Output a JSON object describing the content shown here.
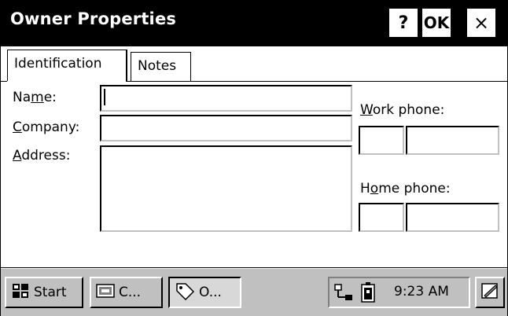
{
  "window": {
    "title": "Owner Properties",
    "help_label": "?",
    "ok_label": "OK",
    "close_label": "×"
  },
  "tabs": [
    {
      "label": "Identification",
      "active": true
    },
    {
      "label": "Notes",
      "active": false
    }
  ],
  "form": {
    "name_label": {
      "pre": "Na",
      "mn": "m",
      "post": "e:"
    },
    "company_label": {
      "pre": "",
      "mn": "C",
      "post": "ompany:"
    },
    "address_label": {
      "pre": "",
      "mn": "A",
      "post": "ddress:"
    },
    "work_phone_label": {
      "pre": "",
      "mn": "W",
      "post": "ork phone:"
    },
    "home_phone_label": {
      "pre": "H",
      "mn": "o",
      "post": "me phone:"
    },
    "name_value": "",
    "company_value": "",
    "address_value": "",
    "work_area_value": "",
    "work_number_value": "",
    "home_area_value": "",
    "home_number_value": ""
  },
  "taskbar": {
    "start_label": "Start",
    "task1_label": "C...",
    "task2_label": "O...",
    "clock": "9:23 AM",
    "icons": {
      "start": "start-flag-icon",
      "task1": "control-panel-icon",
      "task2": "owner-tag-icon",
      "network": "network-icon",
      "battery": "battery-icon",
      "desktop": "show-desktop-icon"
    }
  }
}
